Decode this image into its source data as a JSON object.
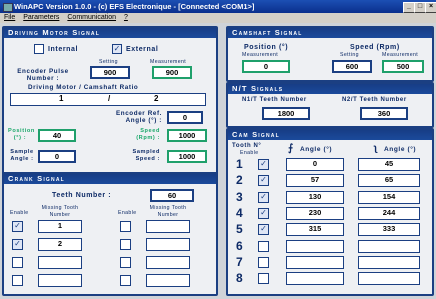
{
  "window": {
    "title": "WinAPC Version 1.0.0 - (c) EFS Electronique - [Connected <COM1>]"
  },
  "menu": [
    "File",
    "Parameters",
    "Communication",
    "?"
  ],
  "driving_motor": {
    "title": "Driving Motor Signal",
    "internal_label": "Internal",
    "external_label": "External",
    "internal_checked": false,
    "external_checked": true,
    "setting_label": "Setting",
    "measurement_label": "Measurement",
    "encoder_pulse_label": "Encoder Pulse Number :",
    "encoder_pulse_setting": "900",
    "encoder_pulse_measurement": "900",
    "ratio_label": "Driving Motor / Camshaft Ratio",
    "ratio_left": "1",
    "ratio_sep": "/",
    "ratio_right": "2",
    "encoder_ref_label": "Encoder Ref. Angle (°) :",
    "encoder_ref_value": "0",
    "position_label": "Position (°) :",
    "position_value": "40",
    "speed_label": "Speed (Rpm) :",
    "speed_value": "1000",
    "sample_angle_label": "Sample Angle :",
    "sample_angle_value": "0",
    "sampled_speed_label": "Sampled Speed :",
    "sampled_speed_value": "1000"
  },
  "crank": {
    "title": "Crank Signal",
    "teeth_label": "Teeth Number :",
    "teeth_value": "60",
    "enable_label": "Enable",
    "missing_label": "Missing Tooth Number",
    "rows_left": [
      {
        "enabled": true,
        "value": "1"
      },
      {
        "enabled": true,
        "value": "2"
      },
      {
        "enabled": false,
        "value": ""
      },
      {
        "enabled": false,
        "value": ""
      }
    ],
    "rows_right": [
      {
        "enabled": false,
        "value": ""
      },
      {
        "enabled": false,
        "value": ""
      },
      {
        "enabled": false,
        "value": ""
      },
      {
        "enabled": false,
        "value": ""
      }
    ]
  },
  "camshaft": {
    "title": "Camshaft Signal",
    "position_label": "Position (°)",
    "speed_label": "Speed (Rpm)",
    "measurement_label": "Measurement",
    "setting_label": "Setting",
    "position_measurement": "0",
    "speed_setting": "600",
    "speed_measurement": "500"
  },
  "nt": {
    "title": "N/T Signals",
    "n1_label": "N1/T Teeth Number",
    "n2_label": "N2/T Teeth Number",
    "n1_value": "1800",
    "n2_value": "360"
  },
  "cam": {
    "title": "Cam Signal",
    "tooth_label": "Tooth N°",
    "enable_label": "Enable",
    "rise_label": "Angle (°)",
    "fall_label": "Angle (°)",
    "rows": [
      {
        "n": "1",
        "enabled": true,
        "rise": "0",
        "fall": "45"
      },
      {
        "n": "2",
        "enabled": true,
        "rise": "57",
        "fall": "65"
      },
      {
        "n": "3",
        "enabled": true,
        "rise": "130",
        "fall": "154"
      },
      {
        "n": "4",
        "enabled": true,
        "rise": "230",
        "fall": "244"
      },
      {
        "n": "5",
        "enabled": true,
        "rise": "315",
        "fall": "333"
      },
      {
        "n": "6",
        "enabled": false,
        "rise": "",
        "fall": ""
      },
      {
        "n": "7",
        "enabled": false,
        "rise": "",
        "fall": ""
      },
      {
        "n": "8",
        "enabled": false,
        "rise": "",
        "fall": ""
      }
    ]
  }
}
